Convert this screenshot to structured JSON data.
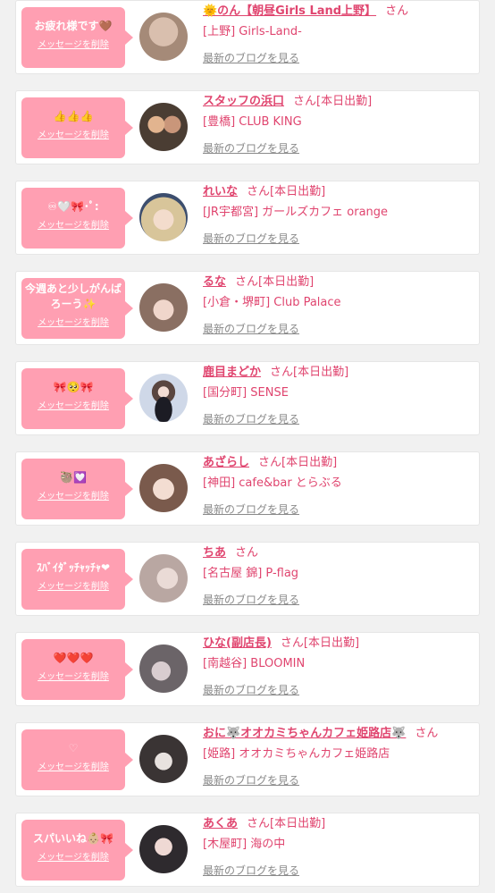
{
  "messages": [
    {
      "message": "お疲れ様です🤎",
      "delete_label": "メッセージを削除",
      "name": "🌞のん【朝昼Girls Land上野】",
      "honorific": "さん",
      "status": "",
      "location": "[上野] Girls-Land-",
      "blog_link": "最新のブログを見る",
      "avatar_color": "#a58a78"
    },
    {
      "message": "👍👍👍",
      "delete_label": "メッセージを削除",
      "name": "スタッフの浜口",
      "honorific": "さん",
      "status": "[本日出勤]",
      "location": "[豊橋] CLUB KING",
      "blog_link": "最新のブログを見る",
      "avatar_color": "#4a3d33"
    },
    {
      "message": "♾🤍🎀･ﾟ:",
      "delete_label": "メッセージを削除",
      "name": "れいな",
      "honorific": "さん",
      "status": "[本日出勤]",
      "location": "[JR宇都宮] ガールズカフェ orange",
      "blog_link": "最新のブログを見る",
      "avatar_color": "#d8c59a"
    },
    {
      "message": "今週あと少しがんばろーう✨",
      "delete_label": "メッセージを削除",
      "name": "るな",
      "honorific": "さん",
      "status": "[本日出勤]",
      "location": "[小倉・堺町] Club Palace",
      "blog_link": "最新のブログを見る",
      "avatar_color": "#8a6f62"
    },
    {
      "message": "🎀🥺🎀",
      "delete_label": "メッセージを削除",
      "name": "鹿目まどか",
      "honorific": "さん",
      "status": "[本日出勤]",
      "location": "[国分町] SENSE",
      "blog_link": "最新のブログを見る",
      "avatar_color": "#cfd8e8"
    },
    {
      "message": "🦥💟",
      "delete_label": "メッセージを削除",
      "name": "あざらし",
      "honorific": "さん",
      "status": "[本日出勤]",
      "location": "[神田] cafe&bar とらぶる",
      "blog_link": "最新のブログを見る",
      "avatar_color": "#7a5a4c"
    },
    {
      "message": "ｽﾊﾞｲﾀﾞｯﾁｬｯﾁｬ❤",
      "delete_label": "メッセージを削除",
      "name": "ちあ",
      "honorific": "さん",
      "status": "",
      "location": "[名古屋 錦] P-flag",
      "blog_link": "最新のブログを見る",
      "avatar_color": "#b9a7a2"
    },
    {
      "message": "❤️❤️❤️",
      "delete_label": "メッセージを削除",
      "name": "ひな(副店長)",
      "honorific": "さん",
      "status": "[本日出勤]",
      "location": "[南越谷] BLOOMIN",
      "blog_link": "最新のブログを見る",
      "avatar_color": "#6b6468"
    },
    {
      "message": "♡",
      "delete_label": "メッセージを削除",
      "name": "おに🐺オオカミちゃんカフェ姫路店🐺",
      "honorific": "さん",
      "status": "",
      "location": "[姫路] オオカミちゃんカフェ姫路店",
      "blog_link": "最新のブログを見る",
      "avatar_color": "#3a3434"
    },
    {
      "message": "スパいいね👶🏼🎀",
      "delete_label": "メッセージを削除",
      "name": "あくあ",
      "honorific": "さん",
      "status": "[本日出勤]",
      "location": "[木屋町] 海の中",
      "blog_link": "最新のブログを見る",
      "avatar_color": "#2e2a2e"
    }
  ]
}
